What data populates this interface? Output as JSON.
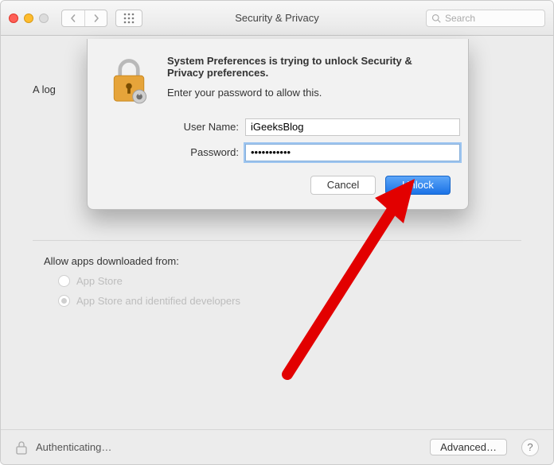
{
  "titlebar": {
    "title": "Security & Privacy",
    "search_placeholder": "Search"
  },
  "panel": {
    "login_msg_prefix": "A log",
    "allow_label": "Allow apps downloaded from:",
    "radio1": "App Store",
    "radio2": "App Store and identified developers"
  },
  "footer": {
    "status": "Authenticating…",
    "advanced": "Advanced…",
    "help": "?"
  },
  "dialog": {
    "title": "System Preferences is trying to unlock Security & Privacy preferences.",
    "subtitle": "Enter your password to allow this.",
    "username_label": "User Name:",
    "username_value": "iGeeksBlog",
    "password_label": "Password:",
    "password_value": "•••••••••••",
    "cancel": "Cancel",
    "unlock": "Unlock"
  }
}
